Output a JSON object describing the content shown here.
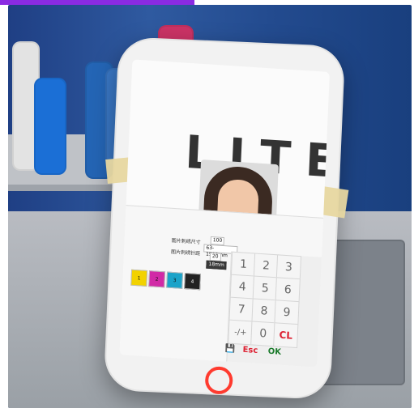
{
  "screen": {
    "logo_text": "LITEC",
    "panel": {
      "label_1": "图片刺绣尺寸",
      "label_2": "图片刺绣针距",
      "values": [
        "100",
        "63-1500mm",
        "20",
        "18mm"
      ]
    },
    "color_swatches": [
      {
        "label": "1",
        "color": "#f2d200"
      },
      {
        "label": "2",
        "color": "#d12aa6"
      },
      {
        "label": "3",
        "color": "#1aa3c9"
      },
      {
        "label": "4",
        "color": "#222222"
      }
    ],
    "keypad": {
      "keys": [
        "1",
        "2",
        "3",
        "4",
        "5",
        "6",
        "7",
        "8",
        "9",
        "-/+",
        "0",
        "CL"
      ]
    },
    "buttons": {
      "save": "💾",
      "esc": "Esc",
      "ok": "OK"
    }
  }
}
